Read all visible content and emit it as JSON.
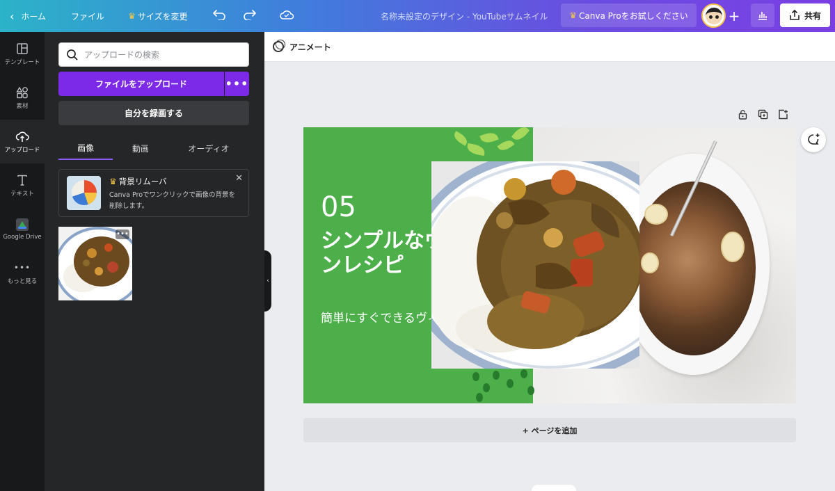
{
  "topbar": {
    "home_label": "ホーム",
    "file_label": "ファイル",
    "resize_label": "サイズを変更",
    "doc_title": "名称未設定のデザイン - YouTubeサムネイル",
    "pro_label": "Canva Proをお試しください",
    "share_label": "共有",
    "icons": [
      "chevron-left-icon",
      "crown-icon",
      "undo-icon",
      "redo-icon",
      "cloud-saved-icon",
      "plus-icon",
      "insights-icon",
      "share-icon"
    ]
  },
  "rail": {
    "items": [
      {
        "label": "テンプレート",
        "icon": "template-icon"
      },
      {
        "label": "素材",
        "icon": "elements-icon"
      },
      {
        "label": "アップロード",
        "icon": "upload-cloud-icon"
      },
      {
        "label": "テキスト",
        "icon": "text-icon"
      },
      {
        "label": "Google Drive",
        "icon": "google-drive-icon"
      },
      {
        "label": "もっと見る",
        "icon": "more-dots-icon"
      }
    ]
  },
  "panel": {
    "search_placeholder": "アップロードの検索",
    "upload_button": "ファイルをアップロード",
    "upload_more": "•••",
    "record_button": "自分を録画する",
    "tabs": [
      "画像",
      "動画",
      "オーディオ"
    ],
    "promo": {
      "title": "背景リムーバ",
      "description": "Canva Proでワンクリックで画像の背景を削除します。",
      "close": "✕"
    },
    "thumb_more": "•••"
  },
  "workspace": {
    "animate_label": "アニメート",
    "add_page_label": "+ ページを追加"
  },
  "design": {
    "number": "05",
    "headline": "シンプルなヴィーガンレシピ",
    "subtitle": "簡単にすぐできるヴィーガ料理のア",
    "colors": {
      "green": "#4daf4a",
      "leaf": "#a6d85b",
      "dots": "#267c2c"
    }
  },
  "colors": {
    "accent_purple": "#7d2ae8",
    "panel_bg": "#252627",
    "rail_bg": "#18191b"
  }
}
